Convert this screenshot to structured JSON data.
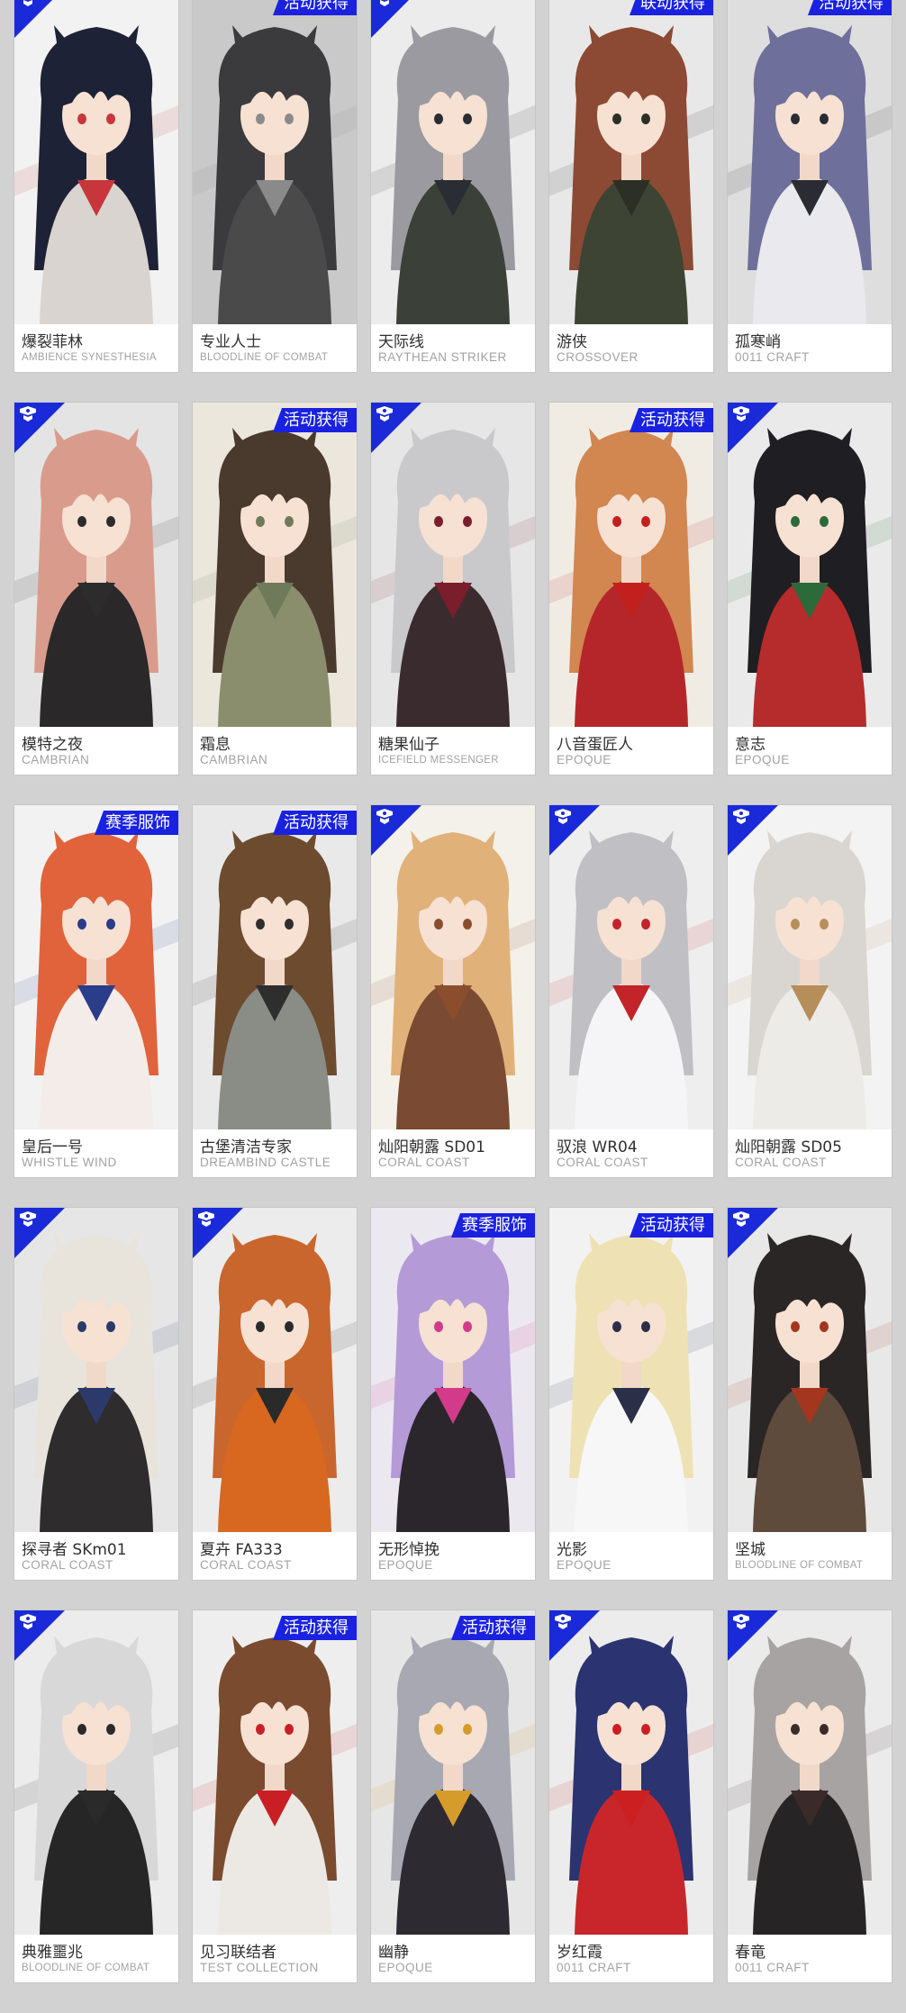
{
  "palette": {
    "corner": "#1a2ad8",
    "badge": "#1a22e0",
    "name_text": "#2f2f2f",
    "series_text": "#a2a2a2",
    "page_bg": "#d2d2d2"
  },
  "cards": [
    {
      "name": "爆裂菲林",
      "series": "AMBIENCE SYNESTHESIA",
      "badge": "",
      "corner": true,
      "hair": "#1d2236",
      "accent": "#c7363b",
      "bg": "#f2f2f2",
      "outfit": "#d9d4cf"
    },
    {
      "name": "专业人士",
      "series": "BLOODLINE OF COMBAT",
      "badge": "活动获得",
      "corner": false,
      "hair": "#3b3b3d",
      "accent": "#8a8a8a",
      "bg": "#c9c9c9",
      "outfit": "#4a4a4a"
    },
    {
      "name": "天际线",
      "series": "RAYTHEAN STRIKER",
      "badge": "",
      "corner": true,
      "hair": "#9a9aa0",
      "accent": "#2a2d33",
      "bg": "#ececec",
      "outfit": "#3b4038"
    },
    {
      "name": "游侠",
      "series": "CROSSOVER",
      "badge": "联动获得",
      "corner": false,
      "hair": "#8c4a34",
      "accent": "#2c2f26",
      "bg": "#e8e8e8",
      "outfit": "#3d4433"
    },
    {
      "name": "孤寒峭",
      "series": "0011 CRAFT",
      "badge": "活动获得",
      "corner": false,
      "hair": "#6e6f9a",
      "accent": "#2b2c33",
      "bg": "#dedede",
      "outfit": "#e9e9ee"
    },
    {
      "name": "模特之夜",
      "series": "CAMBRIAN",
      "badge": "",
      "corner": true,
      "hair": "#d99c8c",
      "accent": "#2c2c2c",
      "bg": "#e4e4e4",
      "outfit": "#2a2828"
    },
    {
      "name": "霜息",
      "series": "CAMBRIAN",
      "badge": "活动获得",
      "corner": false,
      "hair": "#4a3a2e",
      "accent": "#6e7a5a",
      "bg": "#ebe7dc",
      "outfit": "#8a8e6c"
    },
    {
      "name": "糖果仙子",
      "series": "ICEFIELD MESSENGER",
      "badge": "",
      "corner": true,
      "hair": "#c9c9cc",
      "accent": "#7a1d2c",
      "bg": "#e6e6e6",
      "outfit": "#3a2b2e"
    },
    {
      "name": "八音蛋匠人",
      "series": "EPOQUE",
      "badge": "活动获得",
      "corner": false,
      "hair": "#d28650",
      "accent": "#c2201f",
      "bg": "#f0ece4",
      "outfit": "#b5262a"
    },
    {
      "name": "意志",
      "series": "EPOQUE",
      "badge": "",
      "corner": true,
      "hair": "#1f1e22",
      "accent": "#2d6a3a",
      "bg": "#eaeaea",
      "outfit": "#b62b2b"
    },
    {
      "name": "皇后一号",
      "series": "WHISTLE WIND",
      "badge": "赛季服饰",
      "corner": false,
      "hair": "#e0633c",
      "accent": "#2a3c8a",
      "bg": "#f2f2f2",
      "outfit": "#f3ece8"
    },
    {
      "name": "古堡清洁专家",
      "series": "DREAMBIND CASTLE",
      "badge": "活动获得",
      "corner": false,
      "hair": "#6d4b2f",
      "accent": "#2e2e2e",
      "bg": "#e9e9e9",
      "outfit": "#8a8d86"
    },
    {
      "name": "灿阳朝露 SD01",
      "series": "CORAL COAST",
      "badge": "",
      "corner": true,
      "hair": "#e0b27a",
      "accent": "#8a4e2e",
      "bg": "#f4f1ea",
      "outfit": "#7a4a32"
    },
    {
      "name": "驭浪 WR04",
      "series": "CORAL COAST",
      "badge": "",
      "corner": true,
      "hair": "#c0c0c4",
      "accent": "#c2242a",
      "bg": "#eeeeee",
      "outfit": "#f5f5f7"
    },
    {
      "name": "灿阳朝露 SD05",
      "series": "CORAL COAST",
      "badge": "",
      "corner": true,
      "hair": "#d9d6d1",
      "accent": "#b58e5a",
      "bg": "#f3f3f3",
      "outfit": "#ecebe7"
    },
    {
      "name": "探寻者 SKm01",
      "series": "CORAL COAST",
      "badge": "",
      "corner": true,
      "hair": "#e8e4dc",
      "accent": "#2b3a6a",
      "bg": "#e6e6e6",
      "outfit": "#2e2c2d"
    },
    {
      "name": "夏卉 FA333",
      "series": "CORAL COAST",
      "badge": "",
      "corner": true,
      "hair": "#c9662e",
      "accent": "#2a2a2a",
      "bg": "#ececec",
      "outfit": "#d86820"
    },
    {
      "name": "无形悼挽",
      "series": "EPOQUE",
      "badge": "赛季服饰",
      "corner": false,
      "hair": "#b49ad6",
      "accent": "#d23a8a",
      "bg": "#ece8f0",
      "outfit": "#2a262c"
    },
    {
      "name": "光影",
      "series": "EPOQUE",
      "badge": "活动获得",
      "corner": false,
      "hair": "#eee2b4",
      "accent": "#2b2f47",
      "bg": "#f2f2f2",
      "outfit": "#f7f7f7"
    },
    {
      "name": "坚城",
      "series": "BLOODLINE OF COMBAT",
      "badge": "",
      "corner": true,
      "hair": "#2a2626",
      "accent": "#a4361f",
      "bg": "#e8e8e8",
      "outfit": "#5e4b3c"
    },
    {
      "name": "典雅噩兆",
      "series": "BLOODLINE OF COMBAT",
      "badge": "",
      "corner": true,
      "hair": "#d8d8d8",
      "accent": "#2a2a2a",
      "bg": "#ececec",
      "outfit": "#262626"
    },
    {
      "name": "见习联结者",
      "series": "TEST COLLECTION",
      "badge": "活动获得",
      "corner": false,
      "hair": "#7a4b2e",
      "accent": "#c91f24",
      "bg": "#eeeeee",
      "outfit": "#ece9e4"
    },
    {
      "name": "幽静",
      "series": "EPOQUE",
      "badge": "活动获得",
      "corner": false,
      "hair": "#a7a8b1",
      "accent": "#d59c2c",
      "bg": "#e6e6e6",
      "outfit": "#2e2a31"
    },
    {
      "name": "岁红霞",
      "series": "0011 CRAFT",
      "badge": "",
      "corner": true,
      "hair": "#2b3470",
      "accent": "#cc1f22",
      "bg": "#ececec",
      "outfit": "#c8262a"
    },
    {
      "name": "春竜",
      "series": "0011 CRAFT",
      "badge": "",
      "corner": true,
      "hair": "#a6a3a2",
      "accent": "#3a2b2a",
      "bg": "#ebebeb",
      "outfit": "#262424"
    }
  ]
}
